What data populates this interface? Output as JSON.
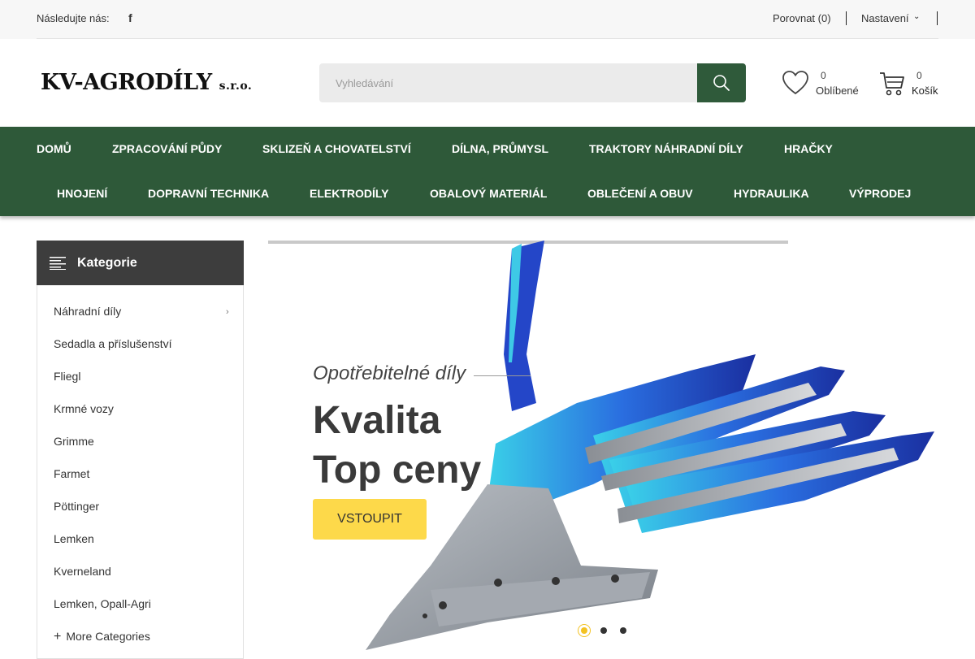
{
  "topbar": {
    "follow_label": "Následujte nás:",
    "facebook_icon": "facebook-icon",
    "compare_label": "Porovnat (0)",
    "settings_label": "Nastavení"
  },
  "header": {
    "logo_main": "KV-AGRODÍLY",
    "logo_suffix": "s.r.o.",
    "search_placeholder": "Vyhledávání",
    "favorites": {
      "count": "0",
      "label": "Oblíbené"
    },
    "cart": {
      "count": "0",
      "label": "Košík"
    }
  },
  "nav": {
    "row1": [
      "DOMŮ",
      "ZPRACOVÁNÍ PŮDY",
      "SKLIZEŇ A CHOVATELSTVÍ",
      "DÍLNA, PRŮMYSL",
      "TRAKTORY NÁHRADNÍ DÍLY",
      "HRAČKY"
    ],
    "row2": [
      "HNOJENÍ",
      "DOPRAVNÍ TECHNIKA",
      "ELEKTRODÍLY",
      "OBALOVÝ MATERIÁL",
      "OBLEČENÍ A OBUV",
      "HYDRAULIKA",
      "VÝPRODEJ"
    ]
  },
  "sidebar": {
    "title": "Kategorie",
    "items": [
      "Náhradní díly",
      "Sedadla a příslušenství",
      "Fliegl",
      "Krmné vozy",
      "Grimme",
      "Farmet",
      "Pöttinger",
      "Lemken",
      "Kverneland",
      "Lemken, Opall-Agri"
    ],
    "more_label": "More Categories"
  },
  "slider": {
    "subtitle": "Opotřebitelné díly",
    "headline_1": "Kvalita",
    "headline_2": "Top ceny",
    "cta_label": "VSTOUPIT",
    "active_slide": 1,
    "slide_count": 3
  },
  "colors": {
    "brand_green": "#2e5939",
    "cta_yellow": "#fdd94a",
    "sidebar_header": "#3d3d3d"
  }
}
